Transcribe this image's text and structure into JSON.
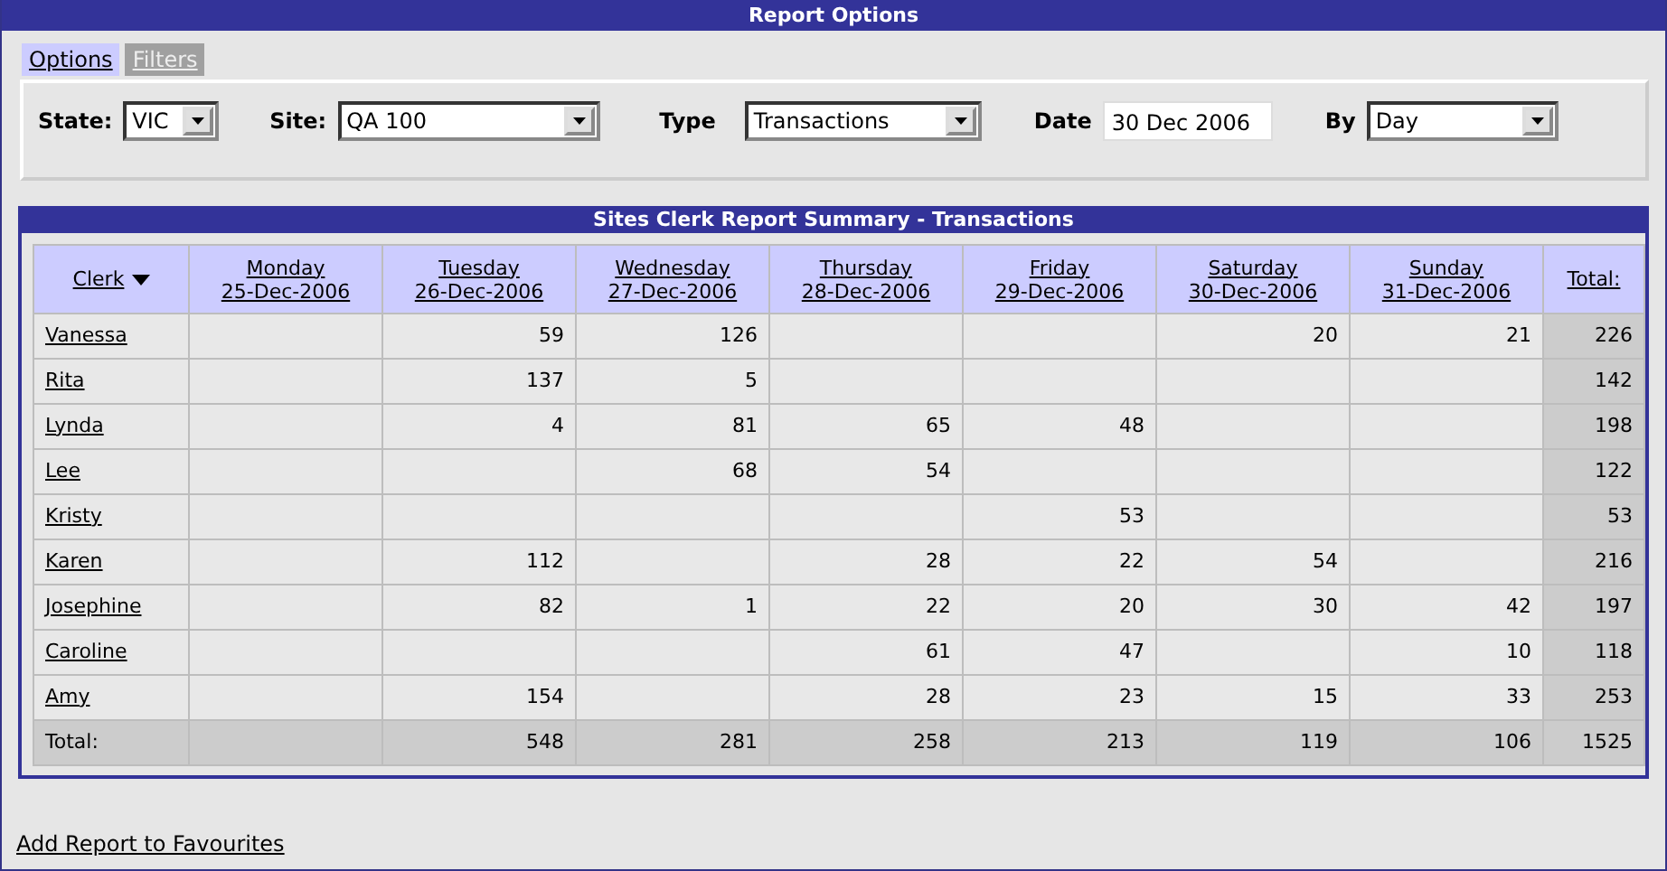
{
  "window": {
    "title": "Report Options"
  },
  "tabs": [
    {
      "label": "Options",
      "selected": true
    },
    {
      "label": "Filters",
      "selected": false
    }
  ],
  "filters": [
    {
      "label": "State:",
      "kind": "select",
      "value": "VIC"
    },
    {
      "label": "Site:",
      "kind": "select",
      "value": "QA 100"
    },
    {
      "label": "Type",
      "kind": "select",
      "value": "Transactions"
    },
    {
      "label": "Date",
      "kind": "text",
      "value": "30 Dec 2006"
    },
    {
      "label": "By",
      "kind": "select",
      "value": "Day"
    }
  ],
  "report": {
    "title": "Sites Clerk Report Summary - Transactions",
    "clerk_column": {
      "label": "Clerk",
      "sorted": true
    },
    "day_columns": [
      {
        "day": "Monday",
        "date": "25-Dec-2006"
      },
      {
        "day": "Tuesday",
        "date": "26-Dec-2006"
      },
      {
        "day": "Wednesday",
        "date": "27-Dec-2006"
      },
      {
        "day": "Thursday",
        "date": "28-Dec-2006"
      },
      {
        "day": "Friday",
        "date": "29-Dec-2006"
      },
      {
        "day": "Saturday",
        "date": "30-Dec-2006"
      },
      {
        "day": "Sunday",
        "date": "31-Dec-2006"
      }
    ],
    "total_column": {
      "label": "Total:"
    },
    "rows": [
      {
        "clerk": "Vanessa",
        "cells": [
          {
            "kind": "empty"
          },
          {
            "kind": "count",
            "value": "59"
          },
          {
            "kind": "count",
            "value": "126"
          },
          {
            "kind": "empty"
          },
          {
            "kind": "empty"
          },
          {
            "kind": "count",
            "value": "20"
          },
          {
            "kind": "count",
            "value": "21"
          }
        ],
        "total": "226"
      },
      {
        "clerk": "Rita",
        "cells": [
          {
            "kind": "empty"
          },
          {
            "kind": "count",
            "value": "137"
          },
          {
            "kind": "count",
            "value": "5"
          },
          {
            "kind": "empty"
          },
          {
            "kind": "empty"
          },
          {
            "kind": "empty"
          },
          {
            "kind": "empty"
          }
        ],
        "total": "142"
      },
      {
        "clerk": "Lynda",
        "cells": [
          {
            "kind": "empty"
          },
          {
            "kind": "count",
            "value": "4"
          },
          {
            "kind": "count",
            "value": "81"
          },
          {
            "kind": "count",
            "value": "65"
          },
          {
            "kind": "count",
            "value": "48"
          },
          {
            "kind": "empty"
          },
          {
            "kind": "empty"
          }
        ],
        "total": "198"
      },
      {
        "clerk": "Lee",
        "cells": [
          {
            "kind": "empty"
          },
          {
            "kind": "empty"
          },
          {
            "kind": "count",
            "value": "68"
          },
          {
            "kind": "count",
            "value": "54"
          },
          {
            "kind": "empty"
          },
          {
            "kind": "empty"
          },
          {
            "kind": "empty"
          }
        ],
        "total": "122"
      },
      {
        "clerk": "Kristy",
        "cells": [
          {
            "kind": "empty"
          },
          {
            "kind": "empty"
          },
          {
            "kind": "empty"
          },
          {
            "kind": "empty"
          },
          {
            "kind": "count",
            "value": "53"
          },
          {
            "kind": "empty"
          },
          {
            "kind": "empty"
          }
        ],
        "total": "53"
      },
      {
        "clerk": "Karen",
        "cells": [
          {
            "kind": "empty"
          },
          {
            "kind": "count",
            "value": "112"
          },
          {
            "kind": "empty"
          },
          {
            "kind": "count",
            "value": "28"
          },
          {
            "kind": "count",
            "value": "22"
          },
          {
            "kind": "count",
            "value": "54"
          },
          {
            "kind": "empty"
          }
        ],
        "total": "216"
      },
      {
        "clerk": "Josephine",
        "cells": [
          {
            "kind": "empty"
          },
          {
            "kind": "count",
            "value": "82"
          },
          {
            "kind": "count",
            "value": "1"
          },
          {
            "kind": "count",
            "value": "22"
          },
          {
            "kind": "count",
            "value": "20"
          },
          {
            "kind": "count",
            "value": "30"
          },
          {
            "kind": "count",
            "value": "42"
          }
        ],
        "total": "197"
      },
      {
        "clerk": "Caroline",
        "cells": [
          {
            "kind": "empty"
          },
          {
            "kind": "empty"
          },
          {
            "kind": "empty"
          },
          {
            "kind": "count",
            "value": "61"
          },
          {
            "kind": "count",
            "value": "47"
          },
          {
            "kind": "empty"
          },
          {
            "kind": "count",
            "value": "10"
          }
        ],
        "total": "118"
      },
      {
        "clerk": "Amy",
        "cells": [
          {
            "kind": "empty"
          },
          {
            "kind": "count",
            "value": "154"
          },
          {
            "kind": "empty"
          },
          {
            "kind": "count",
            "value": "28"
          },
          {
            "kind": "count",
            "value": "23"
          },
          {
            "kind": "count",
            "value": "15"
          },
          {
            "kind": "count",
            "value": "33"
          }
        ],
        "total": "253"
      }
    ],
    "totals": {
      "label": "Total:",
      "cells": [
        {
          "kind": "empty"
        },
        {
          "kind": "count",
          "value": "548"
        },
        {
          "kind": "count",
          "value": "281"
        },
        {
          "kind": "count",
          "value": "258"
        },
        {
          "kind": "count",
          "value": "213"
        },
        {
          "kind": "count",
          "value": "119"
        },
        {
          "kind": "count",
          "value": "106"
        }
      ],
      "total": "1525"
    }
  },
  "footer_link": "Add Report to Favourites"
}
